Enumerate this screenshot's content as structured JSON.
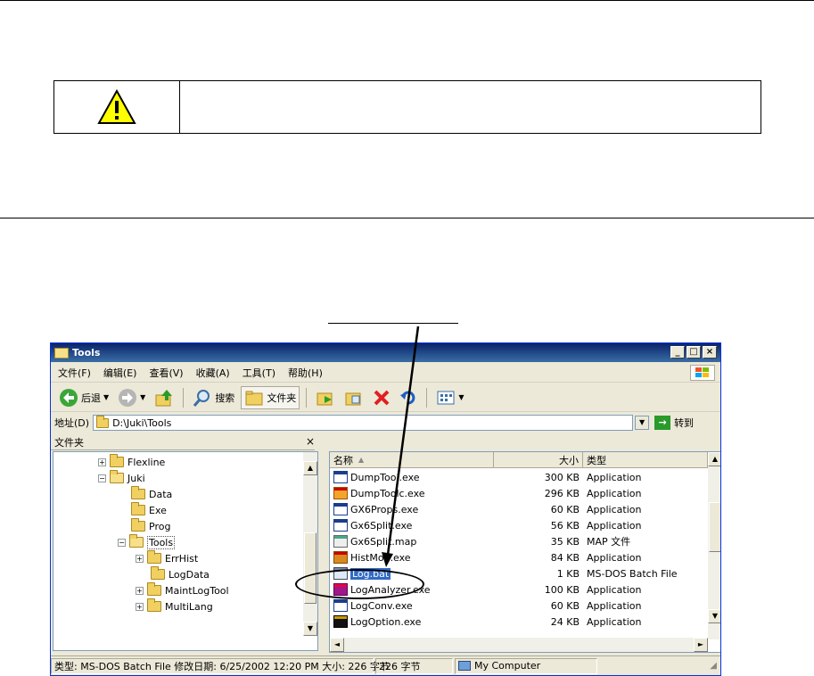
{
  "window": {
    "title": "Tools",
    "buttons": {
      "minimize": "_",
      "maximize": "□",
      "close": "×"
    }
  },
  "menu": [
    "文件(F)",
    "编辑(E)",
    "查看(V)",
    "收藏(A)",
    "工具(T)",
    "帮助(H)"
  ],
  "toolbar": {
    "back": "后退",
    "search": "搜索",
    "folders": "文件夹"
  },
  "address": {
    "label": "地址(D)",
    "value": "D:\\Juki\\Tools",
    "go": "转到"
  },
  "folders_pane": {
    "title": "文件夹",
    "close": "×",
    "nodes": [
      "Flexline",
      "Juki",
      "Data",
      "Exe",
      "Prog",
      "Tools",
      "ErrHist",
      "LogData",
      "MaintLogTool",
      "MultiLang"
    ]
  },
  "list": {
    "columns": {
      "name": "名称",
      "size": "大小",
      "type": "类型"
    },
    "files": [
      {
        "name": "DumpTool.exe",
        "size": "300 KB",
        "type": "Application",
        "icon": "app-icon"
      },
      {
        "name": "DumpToolc.exe",
        "size": "296 KB",
        "type": "Application",
        "icon": "dump-icon"
      },
      {
        "name": "GX6Props.exe",
        "size": "60 KB",
        "type": "Application",
        "icon": "app-icon"
      },
      {
        "name": "Gx6Split.exe",
        "size": "56 KB",
        "type": "Application",
        "icon": "app-icon"
      },
      {
        "name": "Gx6Split.map",
        "size": "35 KB",
        "type": "MAP 文件",
        "icon": "map-file-icon"
      },
      {
        "name": "HistMon.exe",
        "size": "84 KB",
        "type": "Application",
        "icon": "histmon-icon"
      },
      {
        "name": "Log.bat",
        "size": "1 KB",
        "type": "MS-DOS Batch File",
        "icon": "batch-file-icon"
      },
      {
        "name": "LogAnalyzer.exe",
        "size": "100 KB",
        "type": "Application",
        "icon": "analyzer-icon"
      },
      {
        "name": "LogConv.exe",
        "size": "60 KB",
        "type": "Application",
        "icon": "app-icon"
      },
      {
        "name": "LogOption.exe",
        "size": "24 KB",
        "type": "Application",
        "icon": "logoption-icon"
      }
    ]
  },
  "status": {
    "info": "类型: MS-DOS Batch File 修改日期: 6/25/2002 12:20 PM 大小: 226 字节",
    "bytes": "226 字节",
    "zone": "My Computer"
  }
}
